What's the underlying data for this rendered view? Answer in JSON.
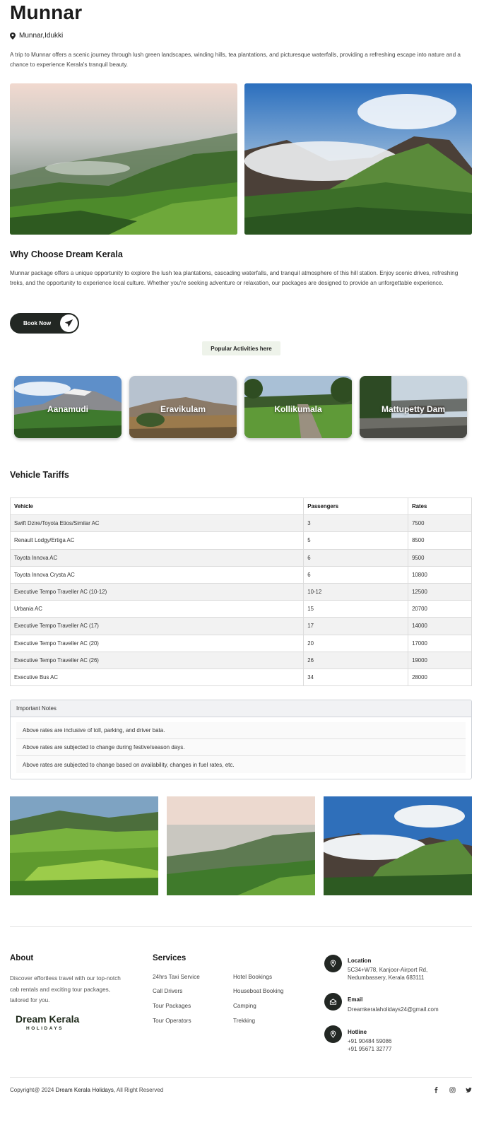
{
  "title": "Munnar",
  "location": "Munnar,Idukki",
  "intro": "A trip to Munnar offers a scenic journey through lush green landscapes, winding hills, tea plantations, and picturesque waterfalls, providing a refreshing escape into nature and a chance to experience Kerala's tranquil beauty.",
  "why": {
    "title": "Why Choose Dream Kerala",
    "text": "Munnar package offers a unique opportunity to explore the lush tea plantations, cascading waterfalls, and tranquil atmosphere of this hill station. Enjoy scenic drives, refreshing treks, and the opportunity to experience local culture. Whether you're seeking adventure or relaxation, our packages are designed to provide an unforgettable experience."
  },
  "book_button": "Book Now",
  "popular_label": "Popular Activities here",
  "activities": [
    "Aanamudi",
    "Eravikulam",
    "Kollikumala",
    "Mattupetty Dam"
  ],
  "tariffs": {
    "title": "Vehicle Tariffs",
    "headers": [
      "Vehicle",
      "Passengers",
      "Rates"
    ],
    "rows": [
      [
        "Swift Dzire/Toyota Etios/Similar AC",
        "3",
        "7500"
      ],
      [
        "Renault Lodgy/Ertiga AC",
        "5",
        "8500"
      ],
      [
        "Toyota Innova AC",
        "6",
        "9500"
      ],
      [
        "Toyota Innova Crysta AC",
        "6",
        "10800"
      ],
      [
        "Executive Tempo Traveller AC (10-12)",
        "10-12",
        "12500"
      ],
      [
        "Urbania AC",
        "15",
        "20700"
      ],
      [
        "Executive Tempo Traveller AC (17)",
        "17",
        "14000"
      ],
      [
        "Executive Tempo Traveller AC (20)",
        "20",
        "17000"
      ],
      [
        "Executive Tempo Traveller AC (26)",
        "26",
        "19000"
      ],
      [
        "Executive Bus AC",
        "34",
        "28000"
      ]
    ]
  },
  "notes": {
    "title": "Important Notes",
    "items": [
      "Above rates are inclusive of toll, parking, and driver bata.",
      "Above rates are subjected to change during festive/season days.",
      "Above rates are subjected to change based on availability, changes in fuel rates, etc."
    ]
  },
  "footer": {
    "about_title": "About",
    "about_text": "Discover effortless travel with our top-notch cab rentals and exciting tour packages, tailored for you.",
    "logo_main": "Dream Kerala",
    "logo_sub": "HOLIDAYS",
    "services_title": "Services",
    "services_col1": [
      "24hrs Taxi Service",
      "Call Drivers",
      "Tour Packages",
      "Tour Operators"
    ],
    "services_col2": [
      "Hotel Bookings",
      "Houseboat Booking",
      "Camping",
      "Trekking"
    ],
    "location_label": "Location",
    "location_lines": [
      "5C34+W78, Kanjoor-Airport Rd,",
      "Nedumbassery, Kerala 683111"
    ],
    "email_label": "Email",
    "email": "Dreamkeralaholidays24@gmail.com",
    "hotline_label": "Hotline",
    "hotline_lines": [
      "+91 90484 59086",
      "+91 95671 32777"
    ],
    "copyright_prefix": "Copyright@ 2024",
    "copyright_brand": "Dream Kerala Holidays",
    "copyright_suffix": ", All Right Reserved"
  },
  "icons": {
    "location": "map-pin-icon",
    "send": "paper-plane-icon",
    "email": "envelope-icon",
    "hotline": "map-pin-icon",
    "social": [
      "facebook-icon",
      "instagram-icon",
      "twitter-icon"
    ]
  }
}
